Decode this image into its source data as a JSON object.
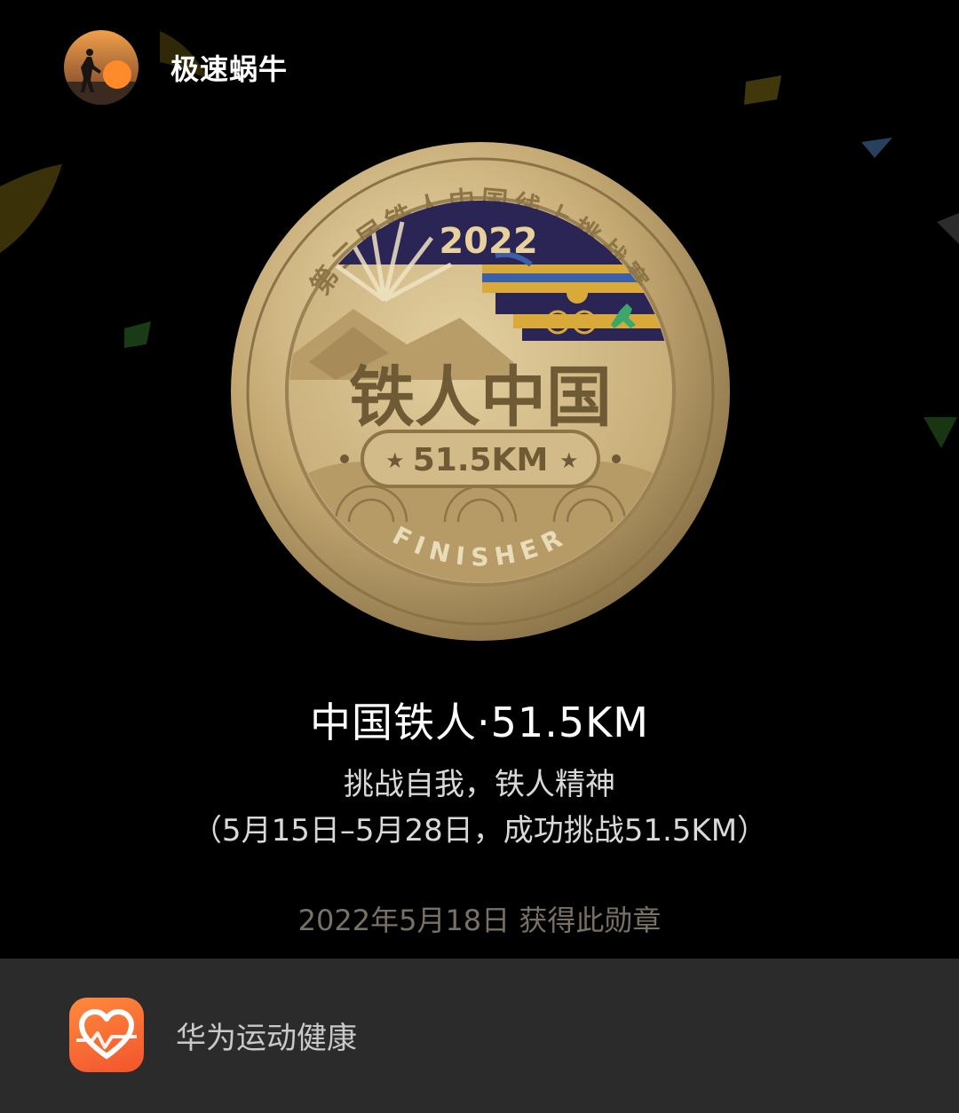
{
  "header": {
    "user_name": "极速蜗牛",
    "avatar_icon": "avatar-silhouette-sunset"
  },
  "medal": {
    "ring_text": "第二届铁人中国线上挑战赛",
    "year": "2022",
    "center_title": "铁人中国",
    "distance_badge": "51.5KM",
    "finisher_text": "FINISHER",
    "colors": {
      "gold": "#c9b27a",
      "navy": "#2a2555",
      "blue_band": "#3b5fa8",
      "gold_band": "#d9a93a",
      "green_band": "#3aa86b"
    }
  },
  "badge_info": {
    "title": "中国铁人·51.5KM",
    "subtitle": "挑战自我，铁人精神",
    "description": "（5月15日–5月28日，成功挑战51.5KM）",
    "earned_date": "2022年5月18日 获得此勋章"
  },
  "footer": {
    "app_name": "华为运动健康",
    "app_icon": "heart-health-icon",
    "accent_color": "#f5622f"
  }
}
